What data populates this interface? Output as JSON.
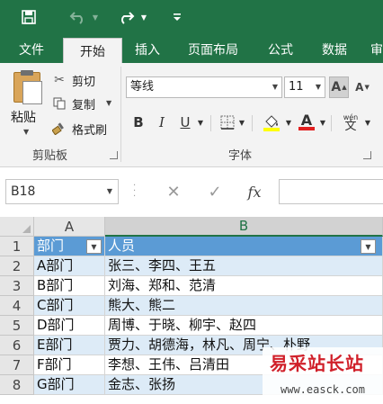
{
  "qat": {
    "save_icon": "save-icon",
    "undo_icon": "undo-icon",
    "redo_icon": "redo-icon",
    "customize_icon": "customize-icon"
  },
  "tabs": [
    {
      "label": "文件",
      "active": false
    },
    {
      "label": "开始",
      "active": true
    },
    {
      "label": "插入",
      "active": false
    },
    {
      "label": "页面布局",
      "active": false
    },
    {
      "label": "公式",
      "active": false
    },
    {
      "label": "数据",
      "active": false
    },
    {
      "label": "审",
      "active": false
    }
  ],
  "clipboard": {
    "paste": "粘贴",
    "cut": "剪切",
    "copy": "复制",
    "format_painter": "格式刷",
    "group_label": "剪贴板"
  },
  "font": {
    "name": "等线",
    "size": "11",
    "bold": "B",
    "italic": "I",
    "underline": "U",
    "grow": "A",
    "shrink": "A",
    "color_glyph": "A",
    "phonetic": "wén",
    "group_label": "字体",
    "fill_color": "#ffff00",
    "font_color": "#e11f1f"
  },
  "formula_bar": {
    "name_box": "B18",
    "fx": "fx",
    "content": ""
  },
  "grid": {
    "columns": [
      "A",
      "B"
    ],
    "header": {
      "row": "1",
      "a": "部门",
      "b": "人员"
    },
    "rows": [
      {
        "row": "2",
        "a": "A部门",
        "b": "张三、李四、王五"
      },
      {
        "row": "3",
        "a": "B部门",
        "b": "刘海、郑和、范清"
      },
      {
        "row": "4",
        "a": "C部门",
        "b": "熊大、熊二"
      },
      {
        "row": "5",
        "a": "D部门",
        "b": "周博、于晓、柳宇、赵四"
      },
      {
        "row": "6",
        "a": "E部门",
        "b": "贾力、胡德海，林凡、周宁、朴野"
      },
      {
        "row": "7",
        "a": "F部门",
        "b": "李想、王伟、吕清田"
      },
      {
        "row": "8",
        "a": "G部门",
        "b": "金志、张扬"
      }
    ],
    "header_color": "#5b9bd5",
    "band_color": "#ddebf7"
  },
  "watermark": {
    "title": "易采站长站",
    "url": "www.easck.com"
  },
  "colors": {
    "ribbon_green": "#217346"
  }
}
